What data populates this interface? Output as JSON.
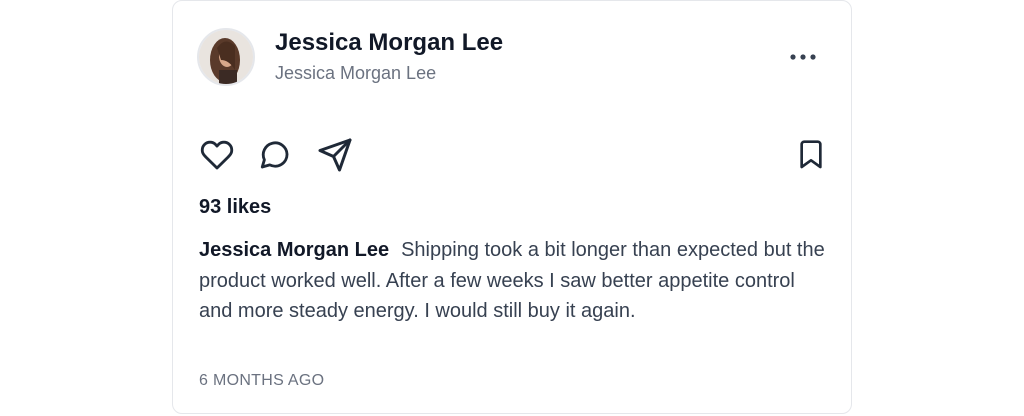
{
  "post": {
    "author_display_name": "Jessica Morgan Lee",
    "author_handle": "Jessica Morgan Lee",
    "likes_text": "93 likes",
    "caption_author": "Jessica Morgan Lee",
    "caption_text": "Shipping took a bit longer than expected but the product worked well. After a few weeks I saw better appetite control and more steady energy. I would still buy it again.",
    "timestamp": "6 MONTHS AGO"
  },
  "icons": {
    "more": "more-horizontal-icon",
    "like": "heart-icon",
    "comment": "comment-icon",
    "share": "paper-plane-icon",
    "save": "bookmark-icon"
  },
  "colors": {
    "icon_stroke": "#1f2937",
    "muted_text": "#6b7280",
    "card_border": "#e5e7eb"
  }
}
